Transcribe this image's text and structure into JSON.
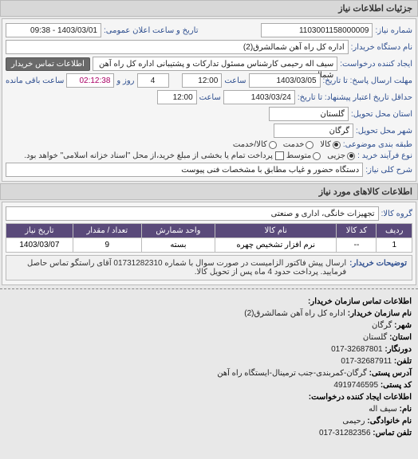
{
  "header": {
    "title": "جزئیات اطلاعات نیاز"
  },
  "fields": {
    "need_no_lbl": "شماره نیاز:",
    "need_no": "1103001158000009",
    "announce_lbl": "تاریخ و ساعت اعلان عمومی:",
    "announce": "1403/03/01 - 09:38",
    "buyer_org_lbl": "نام دستگاه خریدار:",
    "buyer_org": "اداره کل راه آهن شمالشرق(2)",
    "buyer_contact_btn": "اطلاعات تماس خریدار",
    "creator_lbl": "ایجاد کننده درخواست:",
    "creator": "سیف اله رحیمی کارشناس مسئول تدارکات و پشتیبانی اداره کل راه آهن شمال",
    "resp_deadline_lbl": "مهلت ارسال پاسخ: تا تاریخ:",
    "resp_date": "1403/03/05",
    "resp_time_lbl": "ساعت",
    "resp_time": "12:00",
    "days_and_lbl": "روز و",
    "resp_days": "4",
    "remain_lbl": "ساعت باقی مانده",
    "remain": "02:12:38",
    "valid_until_lbl": "حداقل تاریخ اعتبار پیشنهاد: تا تاریخ:",
    "valid_date": "1403/03/24",
    "valid_time_lbl": "ساعت",
    "valid_time": "12:00",
    "province_lbl": "استان محل تحویل:",
    "province": "گلستان",
    "city_lbl": "شهر محل تحویل:",
    "city": "گرگان",
    "category_lbl": "طبقه بندی موضوعی:",
    "cat_goods": "کالا",
    "cat_service": "خدمت",
    "cat_both": "کالا/خدمت",
    "procure_lbl": "نوع فرآیند خرید :",
    "proc_minor": "جزیی",
    "proc_medium": "متوسط",
    "proc_note": "پرداخت تمام یا بخشی از مبلغ خرید،از محل \"اسناد خزانه اسلامی\" خواهد بود.",
    "desc_lbl": "شرح کلی نیاز:",
    "desc": "دستگاه حضور و غیاب مطابق با مشخصات فنی پیوست"
  },
  "goods": {
    "title": "اطلاعات کالاهای مورد نیاز",
    "group_lbl": "گروه کالا:",
    "group": "تجهیزات خانگی، اداری و صنعتی",
    "cols": {
      "row": "ردیف",
      "code": "کد کالا",
      "name": "نام کالا",
      "unit": "واحد شمارش",
      "qty": "تعداد / مقدار",
      "date": "تاریخ نیاز"
    },
    "rows": [
      {
        "row": "1",
        "code": "--",
        "name": "نرم افزار تشخیص چهره",
        "unit": "بسته",
        "qty": "9",
        "date": "1403/03/07"
      }
    ]
  },
  "buyer_note": {
    "lbl": "توضیحات خریدار:",
    "text": "ارسال پیش فاکتور الزامیست در صورت سوال با شماره 01731282310 آقای راستگو تماس حاصل فرمایید. پرداخت حدود 4 ماه پس از تحویل کالا."
  },
  "contact": {
    "title1": "اطلاعات تماس سازمان خریدار:",
    "org_lbl": "نام سازمان خریدار:",
    "org": "اداره کل راه آهن شمالشرق(2)",
    "city_lbl": "شهر:",
    "city": "گرگان",
    "province_lbl": "استان:",
    "province": "گلستان",
    "fax_lbl": "دورنگار:",
    "fax": "32687801-017",
    "phone_lbl": "تلفن:",
    "phone": "32687911-017",
    "addr_lbl": "آدرس پستی:",
    "addr": "گرگان-کمربندی-جنب ترمینال-ایستگاه راه آهن",
    "zip_lbl": "کد پستی:",
    "zip": "4919746595",
    "title2": "اطلاعات ایجاد کننده درخواست:",
    "name_lbl": "نام:",
    "name": "سیف اله",
    "lname_lbl": "نام خانوادگی:",
    "lname": "رحیمی",
    "cphone_lbl": "تلفن تماس:",
    "cphone": "31282356-017"
  }
}
